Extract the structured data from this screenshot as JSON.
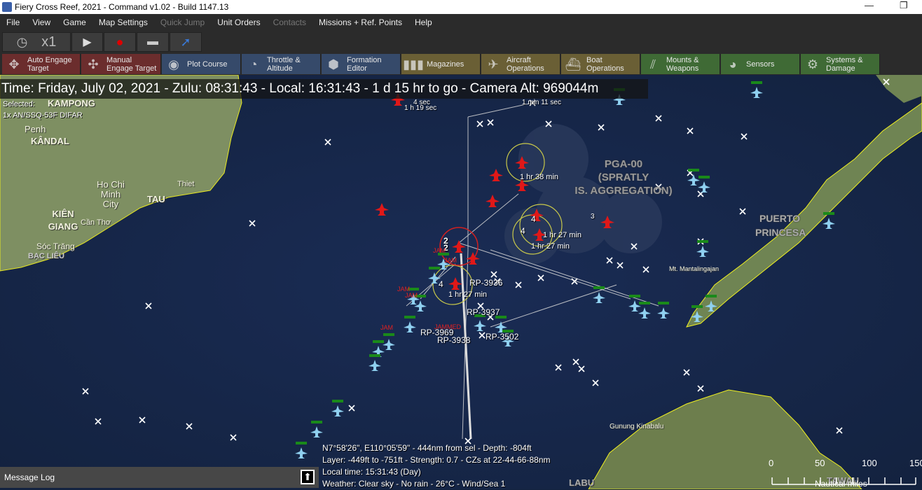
{
  "window": {
    "title": "Fiery Cross Reef, 2021 - Command v1.02 - Build 1147.13",
    "minimize": "—",
    "restore": "❐"
  },
  "menu": [
    "File",
    "View",
    "Game",
    "Map Settings",
    "Quick Jump",
    "Unit Orders",
    "Contacts",
    "Missions + Ref. Points",
    "Help"
  ],
  "menu_disabled": [
    "Quick Jump",
    "Contacts"
  ],
  "toolbar": {
    "clock_icon": "clock-icon",
    "speed": "x1",
    "play_icon": "play-icon",
    "record_icon": "record-icon",
    "layers_icon": "layers-icon",
    "jump_icon": "arrow-icon"
  },
  "commands": [
    {
      "label": "Auto Engage\nTarget",
      "l1": "Auto Engage",
      "l2": "Target",
      "color": "red",
      "icon": "✥"
    },
    {
      "label": "Manual Engage Target",
      "l1": "Manual",
      "l2": "Engage Target",
      "color": "red",
      "icon": "✣"
    },
    {
      "label": "Plot Course",
      "l1": "Plot Course",
      "l2": "",
      "color": "blue",
      "icon": "◉"
    },
    {
      "label": "Throttle & Altitude",
      "l1": "Throttle &",
      "l2": "Altitude",
      "color": "blue",
      "icon": "◔"
    },
    {
      "label": "Formation Editor",
      "l1": "Formation",
      "l2": "Editor",
      "color": "blue",
      "icon": "⬢"
    },
    {
      "label": "Magazines",
      "l1": "Magazines",
      "l2": "",
      "color": "olive",
      "icon": "▮▮▮"
    },
    {
      "label": "Aircraft Operations",
      "l1": "Aircraft",
      "l2": "Operations",
      "color": "olive",
      "icon": "✈"
    },
    {
      "label": "Boat Operations",
      "l1": "Boat",
      "l2": "Operations",
      "color": "olive",
      "icon": "⛴"
    },
    {
      "label": "Mounts & Weapons",
      "l1": "Mounts &",
      "l2": "Weapons",
      "color": "green",
      "icon": "⫽"
    },
    {
      "label": "Sensors",
      "l1": "Sensors",
      "l2": "",
      "color": "green",
      "icon": "◕"
    },
    {
      "label": "Systems & Damage",
      "l1": "Systems &",
      "l2": "Damage",
      "color": "green",
      "icon": "⚙"
    }
  ],
  "timebar": "Time: Friday, July 02, 2021 - Zulu: 08:31:43 - Local: 16:31:43 - 1 d 15 hr to go -  Camera Alt: 969044m",
  "selected": {
    "label": "Selected:",
    "item": "1x AN/SSQ-53F DIFAR"
  },
  "land_labels": [
    "KAMPONG",
    "KÂNDAL",
    "Penh",
    "Ho Chi Minh City",
    "Thiet",
    "TAU",
    "KIÊN GIANG",
    "Cần Thơ",
    "Sóc Trăng",
    "BẠC LIÊU",
    "Mt. Mantalingajan",
    "Gunung Kinabalu",
    "LABU",
    "TAWAU"
  ],
  "ref_area": {
    "line1": "PGA-00",
    "line2": "(SPRATLY",
    "line3": "IS. AGGREGATION)"
  },
  "puerto": "PUERTO PRINCESA",
  "unit_labels": [
    "RP-3936",
    "RP-3937",
    "RP-3938",
    "RP-3969",
    "RP-3502",
    "1 hr 27 min",
    "1 hr 27 min",
    "1 hr 27 min",
    "1 hr 38 min",
    "1 min 11 sec",
    "4 sec",
    "1 h 19 sec",
    "4",
    "4",
    "4",
    "2",
    "2",
    "3"
  ],
  "jam_labels": [
    "JAM",
    "JAM",
    "JAM",
    "JAM",
    "JAM",
    "JAMMED"
  ],
  "status": {
    "line1": "N7°58'26\", E110°05'59\" - 444nm from sel - Depth: -804ft",
    "line2": "Layer: -449ft to -751ft - Strength: 0.7 - CZs at 22-44-66-88nm",
    "line3": "Local time: 15:31:43 (Day)",
    "line4": "Weather: Clear sky - No rain - 26°C - Wind/Sea 1"
  },
  "message_log": {
    "label": "Message Log",
    "expand_icon": "arrow-up-icon"
  },
  "scale": {
    "ticks": [
      "0",
      "50",
      "100",
      "150"
    ],
    "unit": "Nautical miles"
  },
  "colors": {
    "hostile": "#e01818",
    "friendly": "#8fd0f0",
    "sea": "#16264a",
    "land": "#7b8f5a",
    "coast": "#f0f020"
  }
}
